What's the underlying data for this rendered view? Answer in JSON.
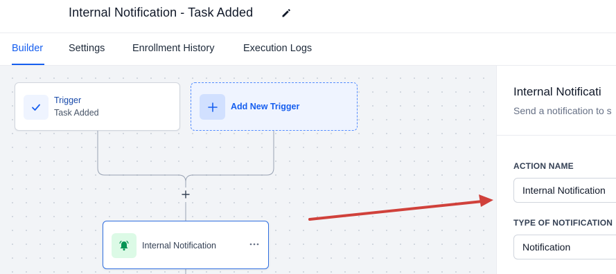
{
  "header": {
    "title": "Internal Notification - Task Added",
    "edit_icon": "pencil-icon"
  },
  "tabs": [
    {
      "label": "Builder",
      "active": true
    },
    {
      "label": "Settings",
      "active": false
    },
    {
      "label": "Enrollment History",
      "active": false
    },
    {
      "label": "Execution Logs",
      "active": false
    }
  ],
  "canvas": {
    "trigger": {
      "title": "Trigger",
      "subtitle": "Task Added",
      "icon": "check-icon"
    },
    "add_trigger": {
      "label": "Add New Trigger",
      "icon": "plus-icon"
    },
    "add_step_icon": "plus-icon",
    "action": {
      "label": "Internal Notification",
      "icon": "bell-icon",
      "menu_icon": "more-horizontal-icon"
    }
  },
  "panel": {
    "title": "Internal Notificati",
    "subtitle": "Send a notification to s",
    "action_name": {
      "label": "ACTION NAME",
      "value": "Internal Notification"
    },
    "type_of_notification": {
      "label": "TYPE OF NOTIFICATION",
      "value": "Notification"
    }
  },
  "colors": {
    "accent": "#155eef",
    "annotation_arrow": "#d0413b",
    "bell": "#079455"
  }
}
